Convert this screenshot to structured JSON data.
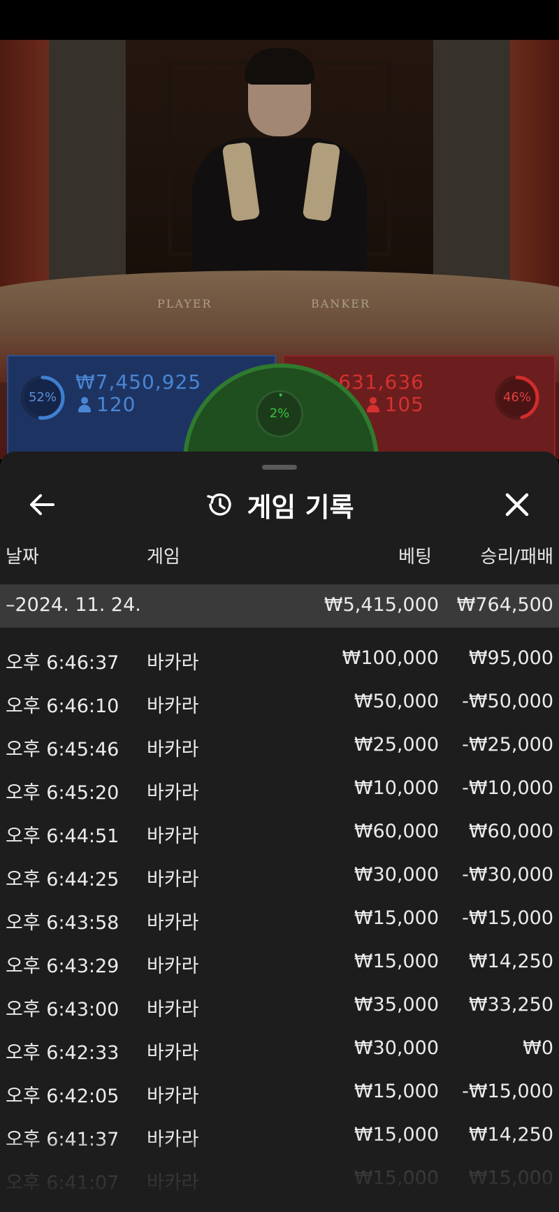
{
  "video": {
    "table_label_player": "PLAYER",
    "table_label_banker": "BANKER"
  },
  "bets": {
    "player": {
      "percent_label": "52%",
      "percent": 52,
      "amount": "₩7,450,925",
      "players": "120",
      "color": "#3f7fd0"
    },
    "tie": {
      "percent_label": "2%",
      "percent": 2,
      "color": "#3cc13c"
    },
    "banker": {
      "percent_label": "46%",
      "percent": 46,
      "amount": "₩6,631,636",
      "players": "105",
      "color": "#d22c2c"
    }
  },
  "sheet": {
    "title": "게임 기록",
    "back_icon": "arrow-left-icon",
    "history_icon": "history-clock-icon",
    "close_icon": "close-x-icon",
    "columns": {
      "date": "날짜",
      "game": "게임",
      "bet": "베팅",
      "result": "승리/패배"
    },
    "day": {
      "date": "–2024. 11. 24.",
      "bet_total": "₩5,415,000",
      "result_total": "₩764,500"
    },
    "rows": [
      {
        "time": "오후 6:46:37",
        "game": "바카라",
        "bet": "₩100,000",
        "result": "₩95,000"
      },
      {
        "time": "오후 6:46:10",
        "game": "바카라",
        "bet": "₩50,000",
        "result": "-₩50,000"
      },
      {
        "time": "오후 6:45:46",
        "game": "바카라",
        "bet": "₩25,000",
        "result": "-₩25,000"
      },
      {
        "time": "오후 6:45:20",
        "game": "바카라",
        "bet": "₩10,000",
        "result": "-₩10,000"
      },
      {
        "time": "오후 6:44:51",
        "game": "바카라",
        "bet": "₩60,000",
        "result": "₩60,000"
      },
      {
        "time": "오후 6:44:25",
        "game": "바카라",
        "bet": "₩30,000",
        "result": "-₩30,000"
      },
      {
        "time": "오후 6:43:58",
        "game": "바카라",
        "bet": "₩15,000",
        "result": "-₩15,000"
      },
      {
        "time": "오후 6:43:29",
        "game": "바카라",
        "bet": "₩15,000",
        "result": "₩14,250"
      },
      {
        "time": "오후 6:43:00",
        "game": "바카라",
        "bet": "₩35,000",
        "result": "₩33,250"
      },
      {
        "time": "오후 6:42:33",
        "game": "바카라",
        "bet": "₩30,000",
        "result": "₩0"
      },
      {
        "time": "오후 6:42:05",
        "game": "바카라",
        "bet": "₩15,000",
        "result": "-₩15,000"
      },
      {
        "time": "오후 6:41:37",
        "game": "바카라",
        "bet": "₩15,000",
        "result": "₩14,250"
      },
      {
        "time": "오후 6:41:07",
        "game": "바카라",
        "bet": "₩15,000",
        "result": "₩15,000"
      }
    ]
  }
}
